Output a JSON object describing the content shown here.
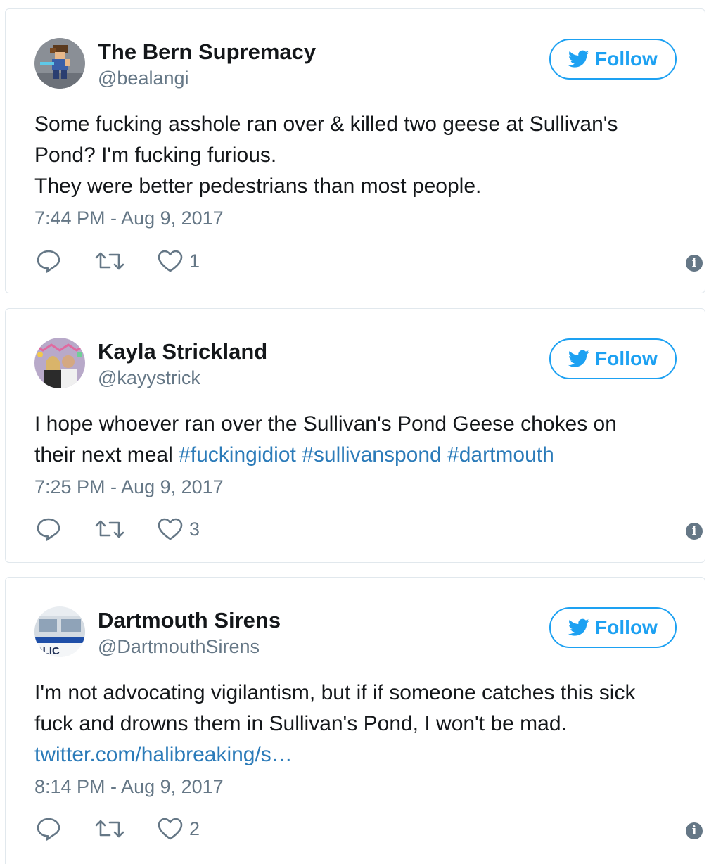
{
  "tweets": [
    {
      "name": "The Bern Supremacy",
      "handle": "@bealangi",
      "follow_label": "Follow",
      "lines": [
        [
          {
            "t": "Some fucking asshole ran over & killed two geese at Sullivan's"
          }
        ],
        [
          {
            "t": "Pond? I'm fucking furious."
          }
        ],
        [
          {
            "t": "They were better pedestrians than most people."
          }
        ]
      ],
      "timestamp": "7:44 PM - Aug 9, 2017",
      "likes": "1",
      "avatar_icon": "pixel-art-character-avatar"
    },
    {
      "name": "Kayla Strickland",
      "handle": "@kayystrick",
      "follow_label": "Follow",
      "lines": [
        [
          {
            "t": "I hope whoever ran over the Sullivan's Pond Geese chokes on"
          }
        ],
        [
          {
            "t": "their next meal "
          },
          {
            "t": "#fuckingidiot",
            "kind": "tag"
          },
          {
            "t": " "
          },
          {
            "t": "#sullivanspond",
            "kind": "tag"
          },
          {
            "t": " "
          },
          {
            "t": "#dartmouth",
            "kind": "tag"
          }
        ]
      ],
      "timestamp": "7:25 PM - Aug 9, 2017",
      "likes": "3",
      "avatar_icon": "party-photo-avatar"
    },
    {
      "name": "Dartmouth Sirens",
      "handle": "@DartmouthSirens",
      "follow_label": "Follow",
      "lines": [
        [
          {
            "t": "I'm not advocating vigilantism, but if if someone catches this sick"
          }
        ],
        [
          {
            "t": "fuck and drowns them in Sullivan's Pond, I won't be mad."
          }
        ],
        [
          {
            "t": "twitter.com/halibreaking/s…",
            "kind": "link"
          }
        ]
      ],
      "timestamp": "8:14 PM - Aug 9, 2017",
      "likes": "2",
      "avatar_icon": "police-car-avatar",
      "avatar_text": "OLIC"
    }
  ],
  "colors": {
    "accent": "#1da1f2",
    "link": "#2b7bb9",
    "secondary_text": "#657786",
    "border": "#e1e8ed"
  },
  "icons": {
    "follow": "twitter-bird-icon",
    "reply": "reply-icon",
    "retweet": "retweet-icon",
    "like": "heart-icon",
    "info": "info-icon"
  }
}
